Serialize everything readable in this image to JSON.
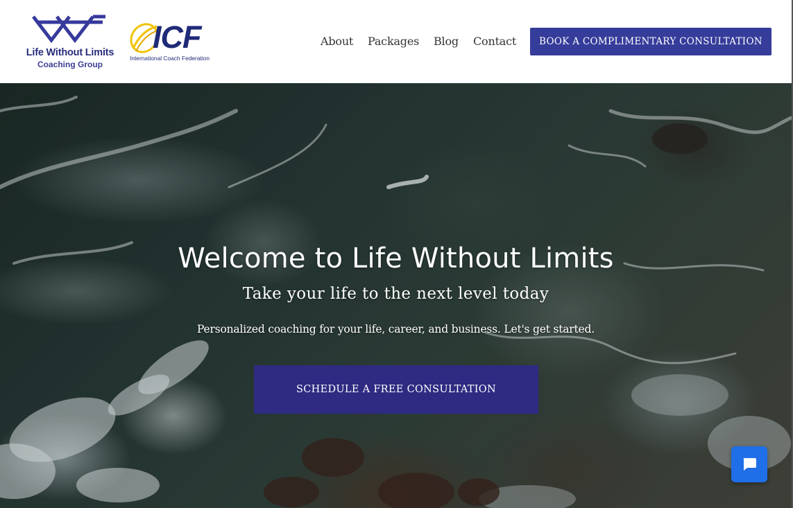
{
  "header": {
    "brand": {
      "name": "Life Without Limits",
      "subtitle": "Coaching Group",
      "color": "#2a2d7c"
    },
    "icf": {
      "letters": "ICF",
      "subtitle": "International Coach Federation",
      "accent": "#f2c200"
    },
    "nav": [
      {
        "label": "About"
      },
      {
        "label": "Packages"
      },
      {
        "label": "Blog"
      },
      {
        "label": "Contact"
      }
    ],
    "book_button": "BOOK A COMPLIMENTARY CONSULTATION",
    "button_color": "#353c9a"
  },
  "hero": {
    "title": "Welcome to Life Without Limits",
    "subtitle": "Take your life to the next level today",
    "description": "Personalized coaching for your life, career, and business. Let's get started.",
    "cta": "SCHEDULE A FREE CONSULTATION",
    "cta_color": "#2f2b82",
    "background": "aerial-ocean-waves-rocks"
  },
  "chat": {
    "icon": "chat-bubble-icon",
    "color": "#1f6fe8"
  }
}
